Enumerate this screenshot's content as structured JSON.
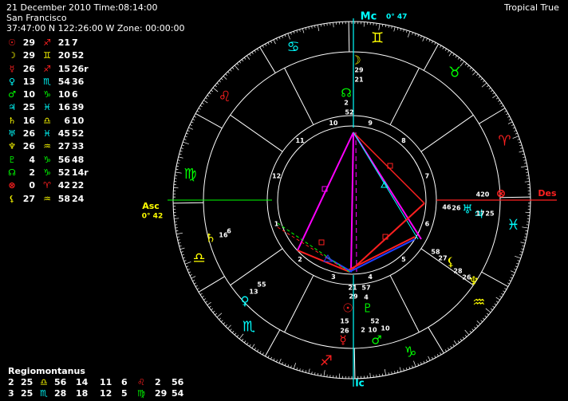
{
  "header": {
    "date_time": "21 December 2010 Time:08:14:00",
    "place": "San Francisco",
    "coords": "37:47:00 N 122:26:00 W Zone: 00:00:00",
    "zodiac_mode": "Tropical True"
  },
  "planets": [
    {
      "glyph": "☉",
      "glyph_color": "#ff2020",
      "deg": "29",
      "sign": "♐",
      "sign_color": "#ff2020",
      "min": "21",
      "sec": "7"
    },
    {
      "glyph": "☽",
      "glyph_color": "#ffff00",
      "deg": "29",
      "sign": "♊",
      "sign_color": "#ffff00",
      "min": "20",
      "sec": "52"
    },
    {
      "glyph": "☿",
      "glyph_color": "#ff2020",
      "deg": "26",
      "sign": "♐",
      "sign_color": "#ff2020",
      "min": "15",
      "sec": "26r"
    },
    {
      "glyph": "♀",
      "glyph_color": "#00ffff",
      "deg": "13",
      "sign": "♏",
      "sign_color": "#00ffff",
      "min": "54",
      "sec": "36"
    },
    {
      "glyph": "♂",
      "glyph_color": "#00ff00",
      "deg": "10",
      "sign": "♑",
      "sign_color": "#00ff00",
      "min": "10",
      "sec": "6"
    },
    {
      "glyph": "♃",
      "glyph_color": "#00ffff",
      "deg": "25",
      "sign": "♓",
      "sign_color": "#00ffff",
      "min": "16",
      "sec": "39"
    },
    {
      "glyph": "♄",
      "glyph_color": "#ffff00",
      "deg": "16",
      "sign": "♎",
      "sign_color": "#ffff00",
      "min": "6",
      "sec": "10"
    },
    {
      "glyph": "♅",
      "glyph_color": "#00ffff",
      "deg": "26",
      "sign": "♓",
      "sign_color": "#00ffff",
      "min": "45",
      "sec": "52"
    },
    {
      "glyph": "♆",
      "glyph_color": "#ffff00",
      "deg": "26",
      "sign": "♒",
      "sign_color": "#ffff00",
      "min": "27",
      "sec": "33"
    },
    {
      "glyph": "♇",
      "glyph_color": "#00ff00",
      "deg": "4",
      "sign": "♑",
      "sign_color": "#00ff00",
      "min": "56",
      "sec": "48"
    },
    {
      "glyph": "☊",
      "glyph_color": "#00ff00",
      "deg": "2",
      "sign": "♑",
      "sign_color": "#00ff00",
      "min": "52",
      "sec": "14r"
    },
    {
      "glyph": "⊗",
      "glyph_color": "#ff2020",
      "deg": "0",
      "sign": "♈",
      "sign_color": "#ff2020",
      "min": "42",
      "sec": "22"
    },
    {
      "glyph": "⚸",
      "glyph_color": "#ffff00",
      "deg": "27",
      "sign": "♒",
      "sign_color": "#ffff00",
      "min": "58",
      "sec": "24"
    }
  ],
  "houses": {
    "title": "Regiomontanus",
    "rows": [
      {
        "h1": "2",
        "d1": "25",
        "s1": "♎",
        "s1_color": "#ffff00",
        "m1": "56",
        "x1": "14",
        "h2": "11",
        "h3": "6",
        "s2": "♌",
        "s2_color": "#ff2020",
        "d2": "2",
        "m2": "56"
      },
      {
        "h1": "3",
        "d1": "25",
        "s1": "♏",
        "s1_color": "#00ffff",
        "m1": "28",
        "x1": "18",
        "h2": "12",
        "h3": "5",
        "s2": "♍",
        "s2_color": "#00ff00",
        "d2": "29",
        "m2": "54"
      }
    ]
  },
  "wheel": {
    "mc_label": "Mc",
    "mc_value": "0° 47",
    "ic_label": "Ic",
    "asc_label": "Asc",
    "asc_value": "0° 42",
    "des_label": "Des",
    "zodiac_signs": [
      {
        "glyph": "♐",
        "color": "#ff2020"
      },
      {
        "glyph": "♑",
        "color": "#00ff00"
      },
      {
        "glyph": "♒",
        "color": "#ffff00"
      },
      {
        "glyph": "♓",
        "color": "#00ffff"
      },
      {
        "glyph": "♈",
        "color": "#ff2020"
      },
      {
        "glyph": "♉",
        "color": "#00ff00"
      },
      {
        "glyph": "♊",
        "color": "#ffff00"
      },
      {
        "glyph": "♋",
        "color": "#00ffff"
      },
      {
        "glyph": "♌",
        "color": "#ff2020"
      },
      {
        "glyph": "♍",
        "color": "#00ff00"
      },
      {
        "glyph": "♎",
        "color": "#ffff00"
      },
      {
        "glyph": "♏",
        "color": "#00ffff"
      }
    ],
    "house_numbers": [
      "1",
      "2",
      "3",
      "4",
      "5",
      "6",
      "7",
      "8",
      "9",
      "10",
      "11",
      "12"
    ],
    "labels": {
      "moon_a": "29",
      "moon_b": "21",
      "node_a": "2",
      "node_b": "52",
      "moon_deg_mc": "29",
      "uranus_pos": "26",
      "jupiter_pos": "17",
      "uranus_m": "46",
      "jupiter_m": "25",
      "pof_deg": "420",
      "chiron_a": "58",
      "chiron_b": "27",
      "neptune_a": "28",
      "neptune_b": "26",
      "saturn_a": "16",
      "saturn_b": "6",
      "venus_a": "13",
      "venus_b": "55",
      "sun_a": "21",
      "sun_b": "29",
      "sun_c": "57",
      "sun_d": "4",
      "merc_a": "15",
      "merc_b": "26",
      "mars_a": "52",
      "mars_b": "2",
      "mars_c": "10",
      "mars_d": "10"
    }
  }
}
